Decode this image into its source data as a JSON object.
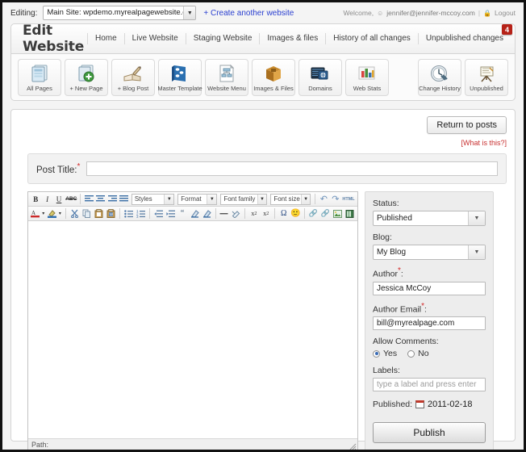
{
  "topbar": {
    "editing_label": "Editing:",
    "site_value": "Main Site: wpdemo.myrealpagewebsite.com",
    "create_link": "+ Create another website",
    "welcome_label": "Welcome,",
    "user_email": "jennifer@jennifer-mccoy.com",
    "separator": "|",
    "logout_label": "Logout",
    "user_icon": "user-icon",
    "lock_icon": "lock-icon"
  },
  "header": {
    "title": "Edit Website",
    "nav": [
      {
        "label": "Home",
        "name": "nav-home"
      },
      {
        "label": "Live Website",
        "name": "nav-live-website"
      },
      {
        "label": "Staging Website",
        "name": "nav-staging-website"
      },
      {
        "label": "Images & files",
        "name": "nav-images-files"
      },
      {
        "label": "History of all changes",
        "name": "nav-history-of-all-changes"
      },
      {
        "label": "Unpublished changes",
        "name": "nav-unpublished-changes"
      }
    ],
    "badge_count": "4",
    "badge_color": "#b62218"
  },
  "icon_toolbar": {
    "buttons": [
      {
        "label": "All Pages",
        "icon": "pages-icon"
      },
      {
        "label": "+ New Page",
        "icon": "new-page-icon"
      },
      {
        "label": "+ Blog Post",
        "icon": "blog-post-icon"
      },
      {
        "label": "Master Template",
        "icon": "master-template-icon"
      },
      {
        "label": "Website Menu",
        "icon": "website-menu-icon"
      },
      {
        "label": "Images & Files",
        "icon": "images-files-icon"
      },
      {
        "label": "Domains",
        "icon": "domains-icon"
      },
      {
        "label": "Web Stats",
        "icon": "web-stats-icon"
      }
    ],
    "right_buttons": [
      {
        "label": "Change History",
        "icon": "change-history-icon"
      },
      {
        "label": "Unpublished",
        "icon": "unpublished-icon"
      }
    ]
  },
  "content": {
    "return_button": "Return to posts",
    "what_is_this": "[What is this?]",
    "post_title_label": "Post Title:",
    "post_title_value": "",
    "post_title_required": "*"
  },
  "editor": {
    "row1": {
      "bold": "B",
      "italic": "I",
      "underline": "U",
      "strikethrough": "ABC",
      "align_left": "align-left-icon",
      "align_center": "align-center-icon",
      "align_right": "align-right-icon",
      "align_justify": "align-justify-icon",
      "styles_select": "Styles",
      "format_select": "Format",
      "font_family_select": "Font family",
      "font_size_select": "Font size",
      "undo": "undo-icon",
      "redo": "redo-icon",
      "html": "HTML"
    },
    "row2": {
      "text_color": "text-color-icon",
      "background_color": "background-color-icon",
      "cut": "cut-icon",
      "copy": "copy-icon",
      "paste": "paste-icon",
      "paste_word": "paste-from-word-icon",
      "bullet_list": "bullet-list-icon",
      "numbered_list": "numbered-list-icon",
      "outdent": "outdent-icon",
      "indent": "indent-icon",
      "blockquote": "blockquote-icon",
      "undo_format": "undo-format-icon",
      "format_painter": "format-painter-icon",
      "horizontal_rule": "horizontal-rule-icon",
      "remove_format": "remove-format-icon",
      "subscript": "subscript-icon",
      "superscript": "superscript-icon",
      "special_char": "special-character-icon",
      "emoticon": "emoticon-icon",
      "link": "link-icon",
      "unlink": "unlink-icon",
      "insert_image": "insert-image-icon",
      "insert_media": "insert-media-icon"
    },
    "path_label": "Path:",
    "body_text": ""
  },
  "sidebar": {
    "status_label": "Status:",
    "status_value": "Published",
    "blog_label": "Blog:",
    "blog_value": "My Blog",
    "author_label": "Author",
    "author_required": "*",
    "author_colon": ":",
    "author_value": "Jessica McCoy",
    "author_email_label": "Author Email",
    "author_email_required": "*",
    "author_email_colon": ":",
    "author_email_value": "bill@myrealpage.com",
    "allow_comments_label": "Allow Comments:",
    "yes_label": "Yes",
    "no_label": "No",
    "allow_comments_value": "Yes",
    "labels_label": "Labels:",
    "labels_placeholder": "type a label and press enter",
    "labels_value": "",
    "published_label": "Published:",
    "published_date": "2011-02-18",
    "calendar_icon": "calendar-icon",
    "publish_button": "Publish"
  }
}
